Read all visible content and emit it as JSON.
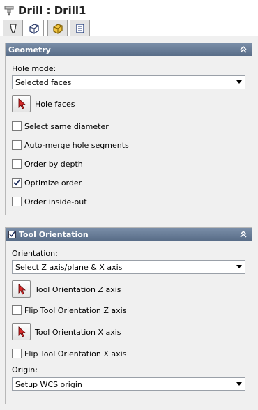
{
  "window": {
    "title": "Drill : Drill1"
  },
  "tabs": [
    {
      "icon": "tool-icon"
    },
    {
      "icon": "geometry-icon"
    },
    {
      "icon": "heights-icon"
    },
    {
      "icon": "passes-icon"
    }
  ],
  "geometry": {
    "header": "Geometry",
    "hole_mode_label": "Hole mode:",
    "hole_mode_value": "Selected faces",
    "hole_faces_label": "Hole faces",
    "options": [
      {
        "label": "Select same diameter",
        "checked": false
      },
      {
        "label": "Auto-merge hole segments",
        "checked": false
      },
      {
        "label": "Order by depth",
        "checked": false
      },
      {
        "label": "Optimize order",
        "checked": true
      },
      {
        "label": "Order inside-out",
        "checked": false
      }
    ]
  },
  "orientation": {
    "header": "Tool Orientation",
    "enabled": true,
    "orientation_label": "Orientation:",
    "orientation_value": "Select Z axis/plane & X axis",
    "z_axis_label": "Tool Orientation Z axis",
    "flip_z_label": "Flip Tool Orientation Z axis",
    "x_axis_label": "Tool Orientation X axis",
    "flip_x_label": "Flip Tool Orientation X axis",
    "origin_label": "Origin:",
    "origin_value": "Setup WCS origin"
  }
}
